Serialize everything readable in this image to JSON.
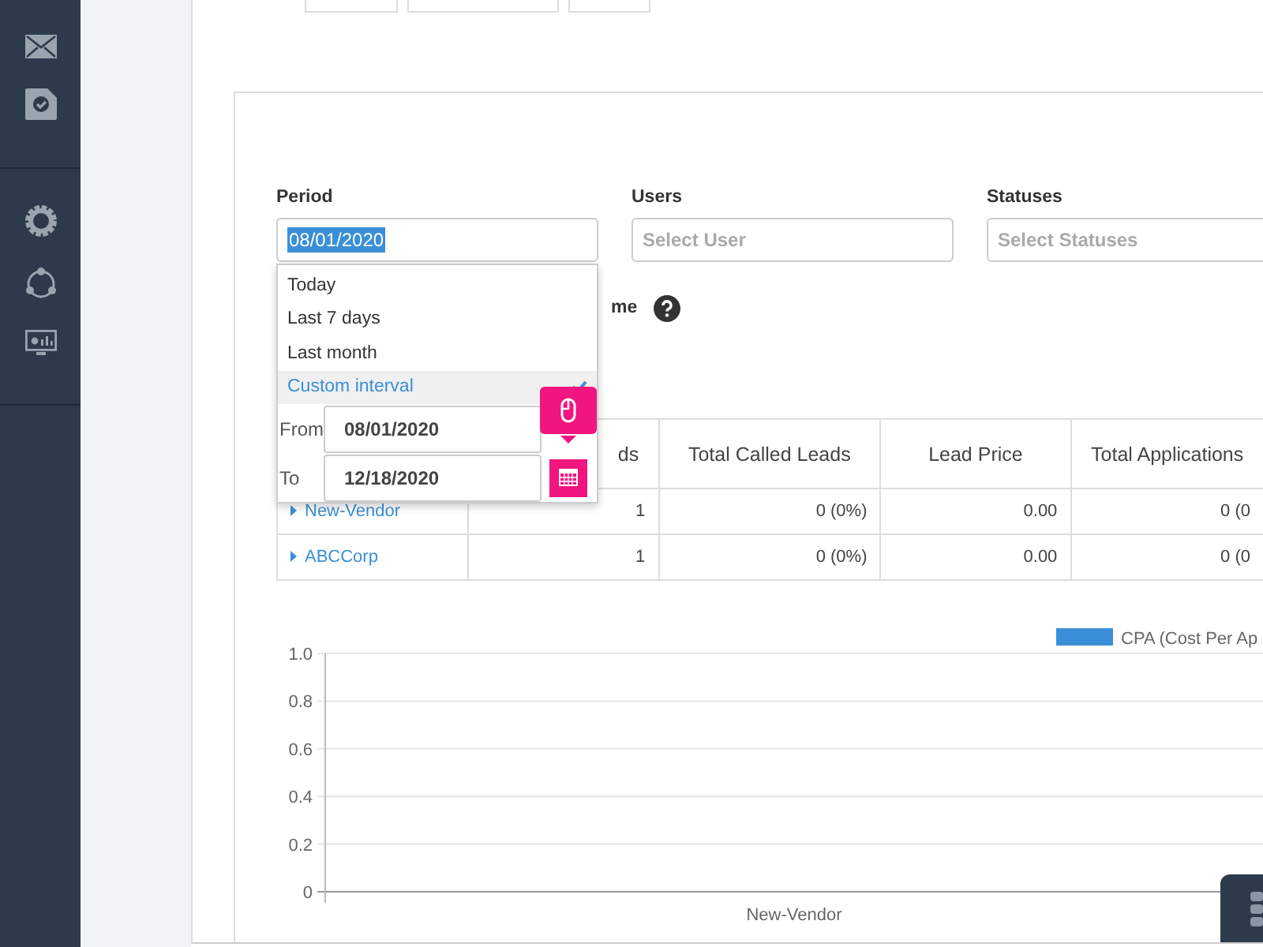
{
  "filters": [
    {
      "label": "Period",
      "value": "08/01/2020"
    },
    {
      "label": "Users",
      "placeholder": "Select User"
    },
    {
      "label": "Statuses",
      "placeholder": "Select Statuses"
    }
  ],
  "partial_label": "me",
  "period_menu": {
    "options": [
      {
        "label": "Today",
        "selected": false
      },
      {
        "label": "Last 7 days",
        "selected": false
      },
      {
        "label": "Last month",
        "selected": false
      },
      {
        "label": "Custom interval",
        "selected": true
      }
    ],
    "from": {
      "label": "From",
      "value": "08/01/2020"
    },
    "to": {
      "label": "To",
      "value": "12/18/2020"
    }
  },
  "table": {
    "columns": [
      {},
      {
        "label": "ds"
      },
      {
        "label": "Total Called Leads"
      },
      {
        "label": "Lead Price"
      },
      {
        "label": "Total Applications"
      }
    ],
    "rows": [
      {
        "expanded": false,
        "cells": [
          "New-Vendor",
          "1",
          "0 (0%)",
          "0.00",
          "0 (0"
        ]
      },
      {
        "expanded": false,
        "cells": [
          "ABCCorp",
          "1",
          "0 (0%)",
          "0.00",
          "0 (0"
        ]
      }
    ]
  },
  "chart_data": {
    "type": "bar",
    "grid": true,
    "categories": [
      "New-Vendor"
    ],
    "series": [
      {
        "name": "CPA (Cost Per Ap",
        "color": "#3a8fd8",
        "values": [
          0
        ]
      }
    ],
    "ylim": [
      0,
      1
    ],
    "yticks": [
      0,
      {
        "value": 0.2,
        "label": "0.2"
      },
      {
        "value": 0.4,
        "label": "0.4"
      },
      {
        "value": 0.6,
        "label": "0.6"
      },
      {
        "value": 0.8,
        "label": "0.8"
      },
      {
        "value": 1,
        "label": "1.0"
      }
    ]
  }
}
